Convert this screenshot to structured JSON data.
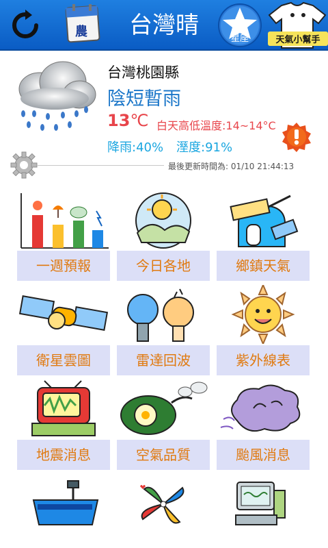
{
  "header": {
    "title": "台灣晴",
    "calendar_label": "農",
    "zodiac_label": "星座",
    "helper_label": "天氣小幫手"
  },
  "current": {
    "location": "台灣桃園縣",
    "condition": "陰短暫雨",
    "temperature": "13",
    "temp_unit": "℃",
    "temp_range": "白天高低溫度:14~14°C",
    "rain": "降雨:40%",
    "humidity": "溼度:91%",
    "updated": "最後更新時間為: 01/10 21:44:13"
  },
  "grid": {
    "items": [
      {
        "label": "一週預報",
        "icon": "week-forecast-chart-icon"
      },
      {
        "label": "今日各地",
        "icon": "today-local-icon"
      },
      {
        "label": "鄉鎮天氣",
        "icon": "township-weather-icon"
      },
      {
        "label": "衛星雲圖",
        "icon": "satellite-icon"
      },
      {
        "label": "雷達回波",
        "icon": "radar-icon"
      },
      {
        "label": "紫外線表",
        "icon": "uv-sun-icon"
      },
      {
        "label": "地震消息",
        "icon": "earthquake-tv-icon"
      },
      {
        "label": "空氣品質",
        "icon": "air-quality-icon"
      },
      {
        "label": "颱風消息",
        "icon": "typhoon-cloud-icon"
      }
    ]
  },
  "colors": {
    "header_bg": "#1473d8",
    "condition": "#1c77c9",
    "temperature": "#e8454b",
    "rain_humidity": "#1aa6e0",
    "tile_label_bg": "#dcdff7",
    "tile_label_text": "#e07a10"
  }
}
